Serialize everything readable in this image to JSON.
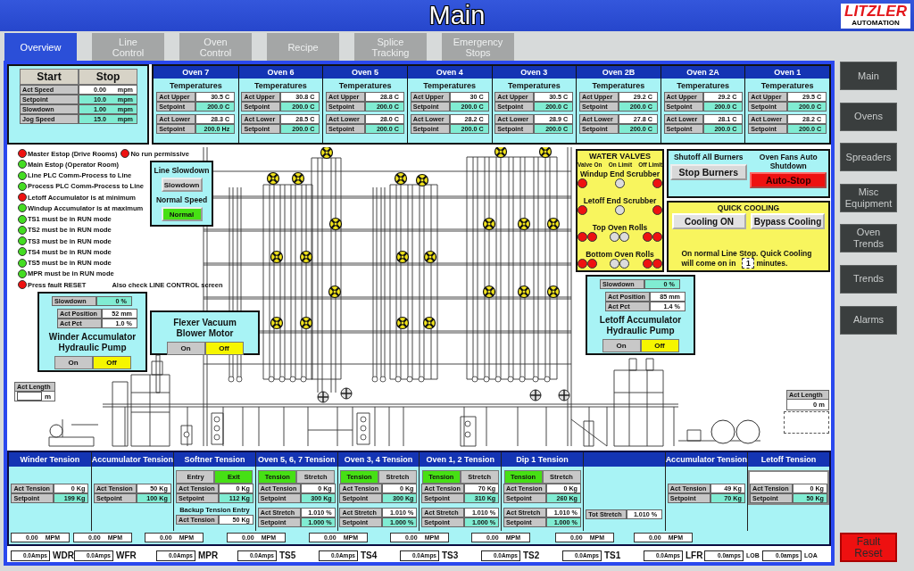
{
  "header": {
    "title": "Main",
    "logo": {
      "name": "LITZLER",
      "tagline": "AUTOMATION"
    }
  },
  "tabs": [
    {
      "label": "Overview",
      "selected": true
    },
    {
      "label": "Line Control",
      "selected": false
    },
    {
      "label": "Oven Control",
      "selected": false
    },
    {
      "label": "Recipe",
      "selected": false
    },
    {
      "label": "Splice Tracking",
      "selected": false
    },
    {
      "label": "Emergency Stops",
      "selected": false
    }
  ],
  "line_speed": {
    "buttons": [
      {
        "label": "Start"
      },
      {
        "label": "Stop"
      }
    ],
    "rows": [
      {
        "label": "Act Speed",
        "value": "0.00",
        "unit": "mpm",
        "kind": "reading"
      },
      {
        "label": "Setpoint",
        "value": "10.0",
        "unit": "mpm",
        "kind": "setpoint"
      },
      {
        "label": "Slowdown",
        "value": "1.00",
        "unit": "mpm",
        "kind": "setpoint"
      },
      {
        "label": "Jog Speed",
        "value": "15.0",
        "unit": "mpm",
        "kind": "setpoint"
      }
    ]
  },
  "ovens": [
    {
      "name": "Oven 7",
      "heading": "Temperatures",
      "groups": [
        [
          {
            "label": "Act Upper",
            "value": "30.5 C",
            "kind": "reading"
          },
          {
            "label": "Setpoint",
            "value": "200.0 C",
            "kind": "setpoint"
          }
        ],
        [
          {
            "label": "Act Lower",
            "value": "28.3 C",
            "kind": "reading"
          },
          {
            "label": "Setpoint",
            "value": "200.0 Hz",
            "kind": "setpoint"
          }
        ]
      ]
    },
    {
      "name": "Oven 6",
      "heading": "Temperatures",
      "groups": [
        [
          {
            "label": "Act Upper",
            "value": "30.8 C",
            "kind": "reading"
          },
          {
            "label": "Setpoint",
            "value": "200.0 C",
            "kind": "setpoint"
          }
        ],
        [
          {
            "label": "Act Lower",
            "value": "28.5 C",
            "kind": "reading"
          },
          {
            "label": "Setpoint",
            "value": "200.0 C",
            "kind": "setpoint"
          }
        ]
      ]
    },
    {
      "name": "Oven 5",
      "heading": "Temperatures",
      "groups": [
        [
          {
            "label": "Act Upper",
            "value": "28.8 C",
            "kind": "reading"
          },
          {
            "label": "Setpoint",
            "value": "200.0 C",
            "kind": "setpoint"
          }
        ],
        [
          {
            "label": "Act Lower",
            "value": "28.0 C",
            "kind": "reading"
          },
          {
            "label": "Setpoint",
            "value": "200.0 C",
            "kind": "setpoint"
          }
        ]
      ]
    },
    {
      "name": "Oven 4",
      "heading": "Temperatures",
      "groups": [
        [
          {
            "label": "Act Upper",
            "value": "30 C",
            "kind": "reading"
          },
          {
            "label": "Setpoint",
            "value": "200.0 C",
            "kind": "setpoint"
          }
        ],
        [
          {
            "label": "Act Lower",
            "value": "28.2 C",
            "kind": "reading"
          },
          {
            "label": "Setpoint",
            "value": "200.0 C",
            "kind": "setpoint"
          }
        ]
      ]
    },
    {
      "name": "Oven 3",
      "heading": "Temperatures",
      "groups": [
        [
          {
            "label": "Act Upper",
            "value": "30.5 C",
            "kind": "reading"
          },
          {
            "label": "Setpoint",
            "value": "200.0 C",
            "kind": "setpoint"
          }
        ],
        [
          {
            "label": "Act Lower",
            "value": "28.9 C",
            "kind": "reading"
          },
          {
            "label": "Setpoint",
            "value": "200.0 C",
            "kind": "setpoint"
          }
        ]
      ]
    },
    {
      "name": "Oven 2B",
      "heading": "Temperatures",
      "groups": [
        [
          {
            "label": "Act Upper",
            "value": "29.2 C",
            "kind": "reading"
          },
          {
            "label": "Setpoint",
            "value": "200.0 C",
            "kind": "setpoint"
          }
        ],
        [
          {
            "label": "Act Lower",
            "value": "27.8 C",
            "kind": "reading"
          },
          {
            "label": "Setpoint",
            "value": "200.0 C",
            "kind": "setpoint"
          }
        ]
      ]
    },
    {
      "name": "Oven 2A",
      "heading": "Temperatures",
      "groups": [
        [
          {
            "label": "Act Upper",
            "value": "29.2 C",
            "kind": "reading"
          },
          {
            "label": "Setpoint",
            "value": "200.0 C",
            "kind": "setpoint"
          }
        ],
        [
          {
            "label": "Act Lower",
            "value": "28.1 C",
            "kind": "reading"
          },
          {
            "label": "Setpoint",
            "value": "200.0 C",
            "kind": "setpoint"
          }
        ]
      ]
    },
    {
      "name": "Oven 1",
      "heading": "Temperatures",
      "groups": [
        [
          {
            "label": "Act Upper",
            "value": "29.5 C",
            "kind": "reading"
          },
          {
            "label": "Setpoint",
            "value": "200.0 C",
            "kind": "setpoint"
          }
        ],
        [
          {
            "label": "Act Lower",
            "value": "28.2 C",
            "kind": "reading"
          },
          {
            "label": "Setpoint",
            "value": "200.0 C",
            "kind": "setpoint"
          }
        ]
      ]
    }
  ],
  "status_lamps": [
    {
      "label": "Master Estop (Drive Rooms)",
      "color": "#ee1111",
      "extra": {
        "label": "No run permissive",
        "color": "#ee1111"
      }
    },
    {
      "label": "Main Estop (Operator Room)",
      "color": "#44dd22"
    },
    {
      "label": "Line PLC Comm-Process to Line",
      "color": "#44dd22"
    },
    {
      "label": "Process PLC Comm-Process to Line",
      "color": "#44dd22"
    },
    {
      "label": "Letoff Accumulator is at minimum",
      "color": "#ee1111"
    },
    {
      "label": "Windup Accumulator is at maximum",
      "color": "#44dd22"
    },
    {
      "label": "TS1 must be in RUN mode",
      "color": "#44dd22"
    },
    {
      "label": "TS2 must be in RUN mode",
      "color": "#44dd22"
    },
    {
      "label": "TS3 must be in RUN mode",
      "color": "#44dd22"
    },
    {
      "label": "TS4 must be in RUN mode",
      "color": "#44dd22"
    },
    {
      "label": "TS5 must be in RUN mode",
      "color": "#44dd22"
    },
    {
      "label": "MPR must be in RUN mode",
      "color": "#44dd22"
    },
    {
      "label": "Press fault RESET",
      "color": "#ee1111",
      "note": "Also check LINE CONTROL screen"
    }
  ],
  "line_slowdown": {
    "title": "Line Slowdown",
    "slowdown_button": {
      "label": "Slowdown",
      "on": false
    },
    "subtitle": "Normal Speed",
    "normal_button": {
      "label": "Normal",
      "on": true
    }
  },
  "winder_accumulator": {
    "slowdown": {
      "label": "Slowdown",
      "value": "0 %",
      "kind": "setpoint"
    },
    "rows": [
      {
        "label": "Act Position",
        "value": "52 mm",
        "kind": "reading"
      },
      {
        "label": "Act Pct",
        "value": "1.0 %",
        "kind": "reading"
      }
    ],
    "title": "Winder Accumulator Hydraulic Pump",
    "buttons": [
      {
        "label": "On",
        "on": false
      },
      {
        "label": "Off",
        "on": true
      }
    ]
  },
  "flexer": {
    "title": "Flexer Vacuum Blower Motor",
    "buttons": [
      {
        "label": "On",
        "on": false
      },
      {
        "label": "Off",
        "on": true
      }
    ]
  },
  "water_valves": {
    "title": "WATER VALVES",
    "columns": [
      "Valve On",
      "On Limit",
      "Off Limit"
    ],
    "groups": [
      {
        "label": "Windup End Scrubber",
        "valve_on": [
          {
            "color": "#ee1111"
          }
        ],
        "on_limit": [
          {
            "color": "#dcdcdc"
          }
        ],
        "off_limit": [
          {
            "color": "#ee1111"
          }
        ]
      },
      {
        "label": "Letoff End Scrubber",
        "valve_on": [
          {
            "color": "#ee1111"
          }
        ],
        "on_limit": [
          {
            "color": "#dcdcdc"
          }
        ],
        "off_limit": [
          {
            "color": "#ee1111"
          }
        ]
      },
      {
        "label": "Top Oven Rolls",
        "valve_on": [
          {
            "color": "#ee1111"
          },
          {
            "color": "#ee1111"
          }
        ],
        "on_limit": [
          {
            "color": "#dcdcdc"
          },
          {
            "color": "#dcdcdc"
          }
        ],
        "off_limit": [
          {
            "color": "#ee1111"
          },
          {
            "color": "#ee1111"
          }
        ]
      },
      {
        "label": "Bottom Oven Rolls",
        "valve_on": [
          {
            "color": "#ee1111"
          },
          {
            "color": "#ee1111"
          }
        ],
        "on_limit": [
          {
            "color": "#dcdcdc"
          },
          {
            "color": "#dcdcdc"
          }
        ],
        "off_limit": [
          {
            "color": "#ee1111"
          },
          {
            "color": "#ee1111"
          }
        ]
      }
    ]
  },
  "burners": {
    "columns": [
      {
        "caption": "Shutoff All Burners",
        "button": {
          "label": "Stop Burners",
          "on": false
        }
      },
      {
        "caption": "Oven Fans Auto Shutdown",
        "button": {
          "label": "Auto-Stop",
          "on": true
        }
      }
    ]
  },
  "quick_cooling": {
    "title": "QUICK COOLING",
    "buttons": [
      {
        "label": "Cooling ON",
        "on": false
      },
      {
        "label": "Bypass Cooling",
        "on": false
      }
    ],
    "note_lines": [
      "On normal Line Stop. Quick Cooling",
      "will come on in"
    ],
    "delay": "1",
    "unit": "minutes."
  },
  "letoff_accumulator": {
    "slowdown": {
      "label": "Slowdown",
      "value": "0 %",
      "kind": "setpoint"
    },
    "rows": [
      {
        "label": "Act Position",
        "value": "85 mm",
        "kind": "reading"
      },
      {
        "label": "Act Pct",
        "value": "1.4 %",
        "kind": "reading"
      }
    ],
    "title": "Letoff Accumulator Hydraulic Pump",
    "buttons": [
      {
        "label": "On",
        "on": false
      },
      {
        "label": "Off",
        "on": true
      }
    ]
  },
  "act_length": [
    {
      "label": "Act Length",
      "unit": "m"
    },
    {
      "label": "Act Length",
      "value": "0 m"
    }
  ],
  "tension_panel": {
    "columns": [
      {
        "title": "Winder Tension",
        "kind": "basic",
        "rows": [
          {
            "label": "Act Tension",
            "value": "0 Kg",
            "kind": "reading"
          },
          {
            "label": "Setpoint",
            "value": "199 Kg",
            "kind": "setpoint"
          }
        ]
      },
      {
        "title": "Accumulator Tension",
        "kind": "basic",
        "rows": [
          {
            "label": "Act Tension",
            "value": "50 Kg",
            "kind": "reading"
          },
          {
            "label": "Setpoint",
            "value": "100 Kg",
            "kind": "setpoint"
          }
        ]
      },
      {
        "title": "Softner Tension",
        "kind": "backup",
        "modes": [
          {
            "label": "Entry",
            "selected": false
          },
          {
            "label": "Exit",
            "selected": true
          }
        ],
        "rows": [
          {
            "label": "Act Tension",
            "value": "0 Kg",
            "kind": "reading"
          },
          {
            "label": "Setpoint",
            "value": "112 Kg",
            "kind": "setpoint"
          }
        ],
        "caption": "Backup Tension Entry",
        "extra_rows": [
          {
            "label": "Act Tension",
            "value": "50 Kg",
            "kind": "reading"
          }
        ]
      },
      {
        "title": "Oven 5, 6, 7 Tension",
        "kind": "stretch",
        "modes": [
          {
            "label": "Tension",
            "selected": true
          },
          {
            "label": "Stretch",
            "selected": false
          }
        ],
        "rows": [
          {
            "label": "Act Tension",
            "value": "0 Kg",
            "kind": "reading"
          },
          {
            "label": "Setpoint",
            "value": "300 Kg",
            "kind": "setpoint"
          }
        ],
        "extra_rows": [
          {
            "label": "Act Stretch",
            "value": "1.010 %",
            "kind": "reading"
          },
          {
            "label": "Setpoint",
            "value": "1.000 %",
            "kind": "setpoint"
          }
        ]
      },
      {
        "title": "Oven 3, 4 Tension",
        "kind": "stretch",
        "modes": [
          {
            "label": "Tension",
            "selected": true
          },
          {
            "label": "Stretch",
            "selected": false
          }
        ],
        "rows": [
          {
            "label": "Act Tension",
            "value": "0 Kg",
            "kind": "reading"
          },
          {
            "label": "Setpoint",
            "value": "300 Kg",
            "kind": "setpoint"
          }
        ],
        "extra_rows": [
          {
            "label": "Act Stretch",
            "value": "1.010 %",
            "kind": "reading"
          },
          {
            "label": "Setpoint",
            "value": "1.000 %",
            "kind": "setpoint"
          }
        ]
      },
      {
        "title": "Oven 1, 2 Tension",
        "kind": "stretch",
        "modes": [
          {
            "label": "Tension",
            "selected": true
          },
          {
            "label": "Stretch",
            "selected": false
          }
        ],
        "rows": [
          {
            "label": "Act Tension",
            "value": "70 Kg",
            "kind": "reading"
          },
          {
            "label": "Setpoint",
            "value": "310 Kg",
            "kind": "setpoint"
          }
        ],
        "extra_rows": [
          {
            "label": "Act Stretch",
            "value": "1.010 %",
            "kind": "reading"
          },
          {
            "label": "Setpoint",
            "value": "1.000 %",
            "kind": "setpoint"
          }
        ]
      },
      {
        "title": "Dip 1 Tension",
        "kind": "stretch",
        "modes": [
          {
            "label": "Tension",
            "selected": true
          },
          {
            "label": "Stretch",
            "selected": false
          }
        ],
        "rows": [
          {
            "label": "Act Tension",
            "value": "0 Kg",
            "kind": "reading"
          },
          {
            "label": "Setpoint",
            "value": "260 Kg",
            "kind": "setpoint"
          }
        ],
        "extra_rows": [
          {
            "label": "Act Stretch",
            "value": "1.010 %",
            "kind": "reading"
          },
          {
            "label": "Setpoint",
            "value": "1.000 %",
            "kind": "setpoint"
          }
        ]
      },
      {
        "kind": "total",
        "rows": [
          {
            "label": "Tot Stretch",
            "value": "1.010 %",
            "kind": "reading"
          }
        ]
      },
      {
        "title": "Accumulator Tension",
        "kind": "basic",
        "rows": [
          {
            "label": "Act Tension",
            "value": "49 Kg",
            "kind": "reading"
          },
          {
            "label": "Setpoint",
            "value": "70 Kg",
            "kind": "setpoint"
          }
        ]
      },
      {
        "title": "Letoff Tension",
        "kind": "framed",
        "rows": [
          {
            "label": "Act Tension",
            "value": "0 Kg",
            "kind": "reading"
          },
          {
            "label": "Setpoint",
            "value": "50 Kg",
            "kind": "setpoint"
          }
        ]
      }
    ],
    "speeds": [
      {
        "value": "0.00",
        "unit": "MPM"
      },
      {
        "value": "0.00",
        "unit": "MPM"
      },
      {
        "value": "0.00",
        "unit": "MPM"
      },
      {
        "value": "0.00",
        "unit": "MPM"
      },
      {
        "value": "0.00",
        "unit": "MPM"
      },
      {
        "value": "0.00",
        "unit": "MPM"
      },
      {
        "value": "0.00",
        "unit": "MPM"
      },
      {
        "value": "0.00",
        "unit": "MPM"
      },
      {
        "value": "0.00",
        "unit": "MPM"
      }
    ]
  },
  "drives": [
    {
      "reading": "0.0Amps",
      "name": "WDR"
    },
    {
      "reading": "0.0Amps",
      "name": "WFR"
    },
    {
      "reading": "0.0Amps",
      "name": "MPR"
    },
    {
      "reading": "0.0Amps",
      "name": "TS5"
    },
    {
      "reading": "0.0Amps",
      "name": "TS4"
    },
    {
      "reading": "0.0Amps",
      "name": "TS3"
    },
    {
      "reading": "0.0Amps",
      "name": "TS2"
    },
    {
      "reading": "0.0Amps",
      "name": "TS1"
    },
    {
      "reading": "0.0Amps",
      "name": "LFR"
    },
    {
      "reading": "0.0amps",
      "name": "LOB"
    },
    {
      "reading": "0.0amps",
      "name": "LOA"
    }
  ],
  "sidebar": {
    "items": [
      {
        "label": "Main",
        "selected": false
      },
      {
        "label": "Ovens",
        "selected": false
      },
      {
        "label": "Spreaders",
        "selected": false
      },
      {
        "label": "Misc Equipment",
        "selected": false
      },
      {
        "label": "Oven Trends",
        "selected": false
      },
      {
        "label": "Trends",
        "selected": false
      },
      {
        "label": "Alarms",
        "selected": false
      }
    ],
    "fault_reset": {
      "label": "Fault Reset"
    }
  }
}
